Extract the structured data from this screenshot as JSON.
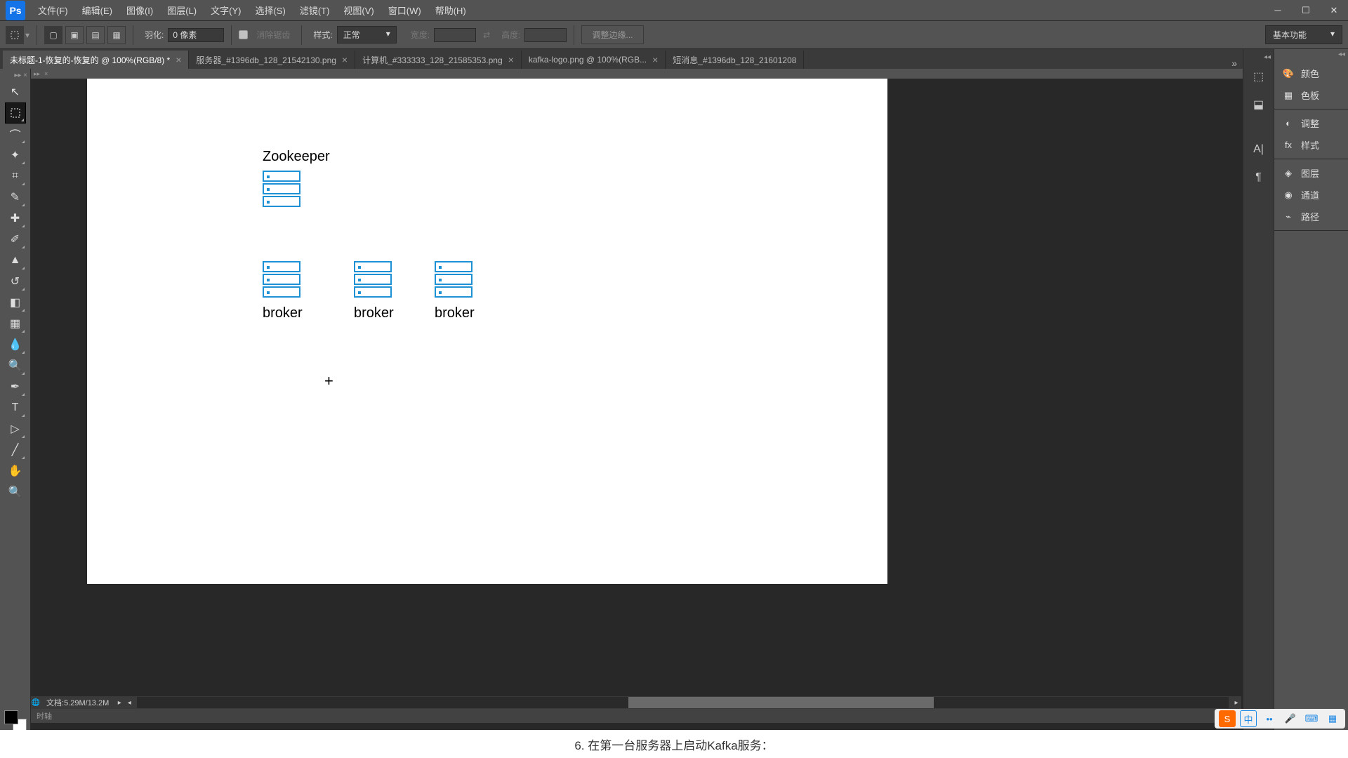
{
  "menu": {
    "file": "文件(F)",
    "edit": "编辑(E)",
    "image": "图像(I)",
    "layer": "图层(L)",
    "type": "文字(Y)",
    "select": "选择(S)",
    "filter": "滤镜(T)",
    "view": "视图(V)",
    "window": "窗口(W)",
    "help": "帮助(H)"
  },
  "options": {
    "feather_label": "羽化:",
    "feather_value": "0 像素",
    "antialias_label": "消除锯齿",
    "style_label": "样式:",
    "style_value": "正常",
    "width_label": "宽度:",
    "height_label": "高度:",
    "refine_btn": "调整边缘...",
    "workspace": "基本功能"
  },
  "tabs": [
    {
      "title": "未标题-1-恢复的-恢复的 @ 100%(RGB/8) *",
      "active": true
    },
    {
      "title": "服务器_#1396db_128_21542130.png",
      "active": false
    },
    {
      "title": "计算机_#333333_128_21585353.png",
      "active": false
    },
    {
      "title": "kafka-logo.png @ 100%(RGB...",
      "active": false
    },
    {
      "title": "短消息_#1396db_128_21601208",
      "active": false
    }
  ],
  "canvas": {
    "zookeeper": "Zookeeper",
    "broker": "broker"
  },
  "status": {
    "doc_label": "文档:",
    "doc_size": "5.29M/13.2M",
    "timeline": "时轴"
  },
  "panels": {
    "color": "颜色",
    "swatches": "色板",
    "adjustments": "调整",
    "styles": "样式",
    "layers": "图层",
    "channels": "通道",
    "paths": "路径"
  },
  "footer": {
    "text": "6. 在第一台服务器上启动Kafka服务："
  },
  "ime": {
    "lang": "中"
  }
}
